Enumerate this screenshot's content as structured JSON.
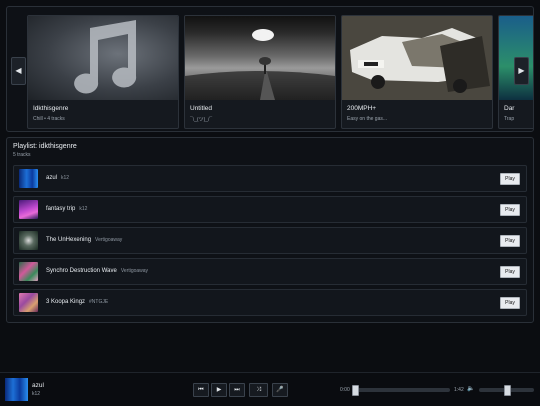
{
  "carousel": {
    "prev_icon": "◀",
    "next_icon": "▶",
    "cards": [
      {
        "title": "Idkthisgenre",
        "subtitle": "Chill • 4 tracks"
      },
      {
        "title": "Untitled",
        "subtitle": "¯\\_(ツ)_/¯"
      },
      {
        "title": "200MPH+",
        "subtitle": "Easy on the gas..."
      },
      {
        "title": "Dar",
        "subtitle": "Trap"
      }
    ]
  },
  "playlist": {
    "title": "Playlist: idkthisgenre",
    "count": "5 tracks",
    "play_label": "Play",
    "tracks": [
      {
        "name": "azul",
        "artist": "k12"
      },
      {
        "name": "fantasy trip",
        "artist": "k12"
      },
      {
        "name": "The UnHexening",
        "artist": "Vertigoaway"
      },
      {
        "name": "Synchro Destruction Wave",
        "artist": "Vertigoaway"
      },
      {
        "name": "3 Koopa Kingz",
        "artist": "#NTGJE"
      }
    ]
  },
  "player": {
    "title": "azul",
    "artist": "k12",
    "current_time": "0:00",
    "duration": "1:42",
    "progress": 0.0,
    "volume": 0.5,
    "controls": {
      "prev": "⏮",
      "play": "▶",
      "next": "⏭",
      "shuffle": "⤨",
      "mic": "🎤"
    },
    "volume_icon": "🔈"
  },
  "colors": {
    "background": "#0b0d11",
    "panel": "#0e1116",
    "accent": "#e8ebef"
  }
}
